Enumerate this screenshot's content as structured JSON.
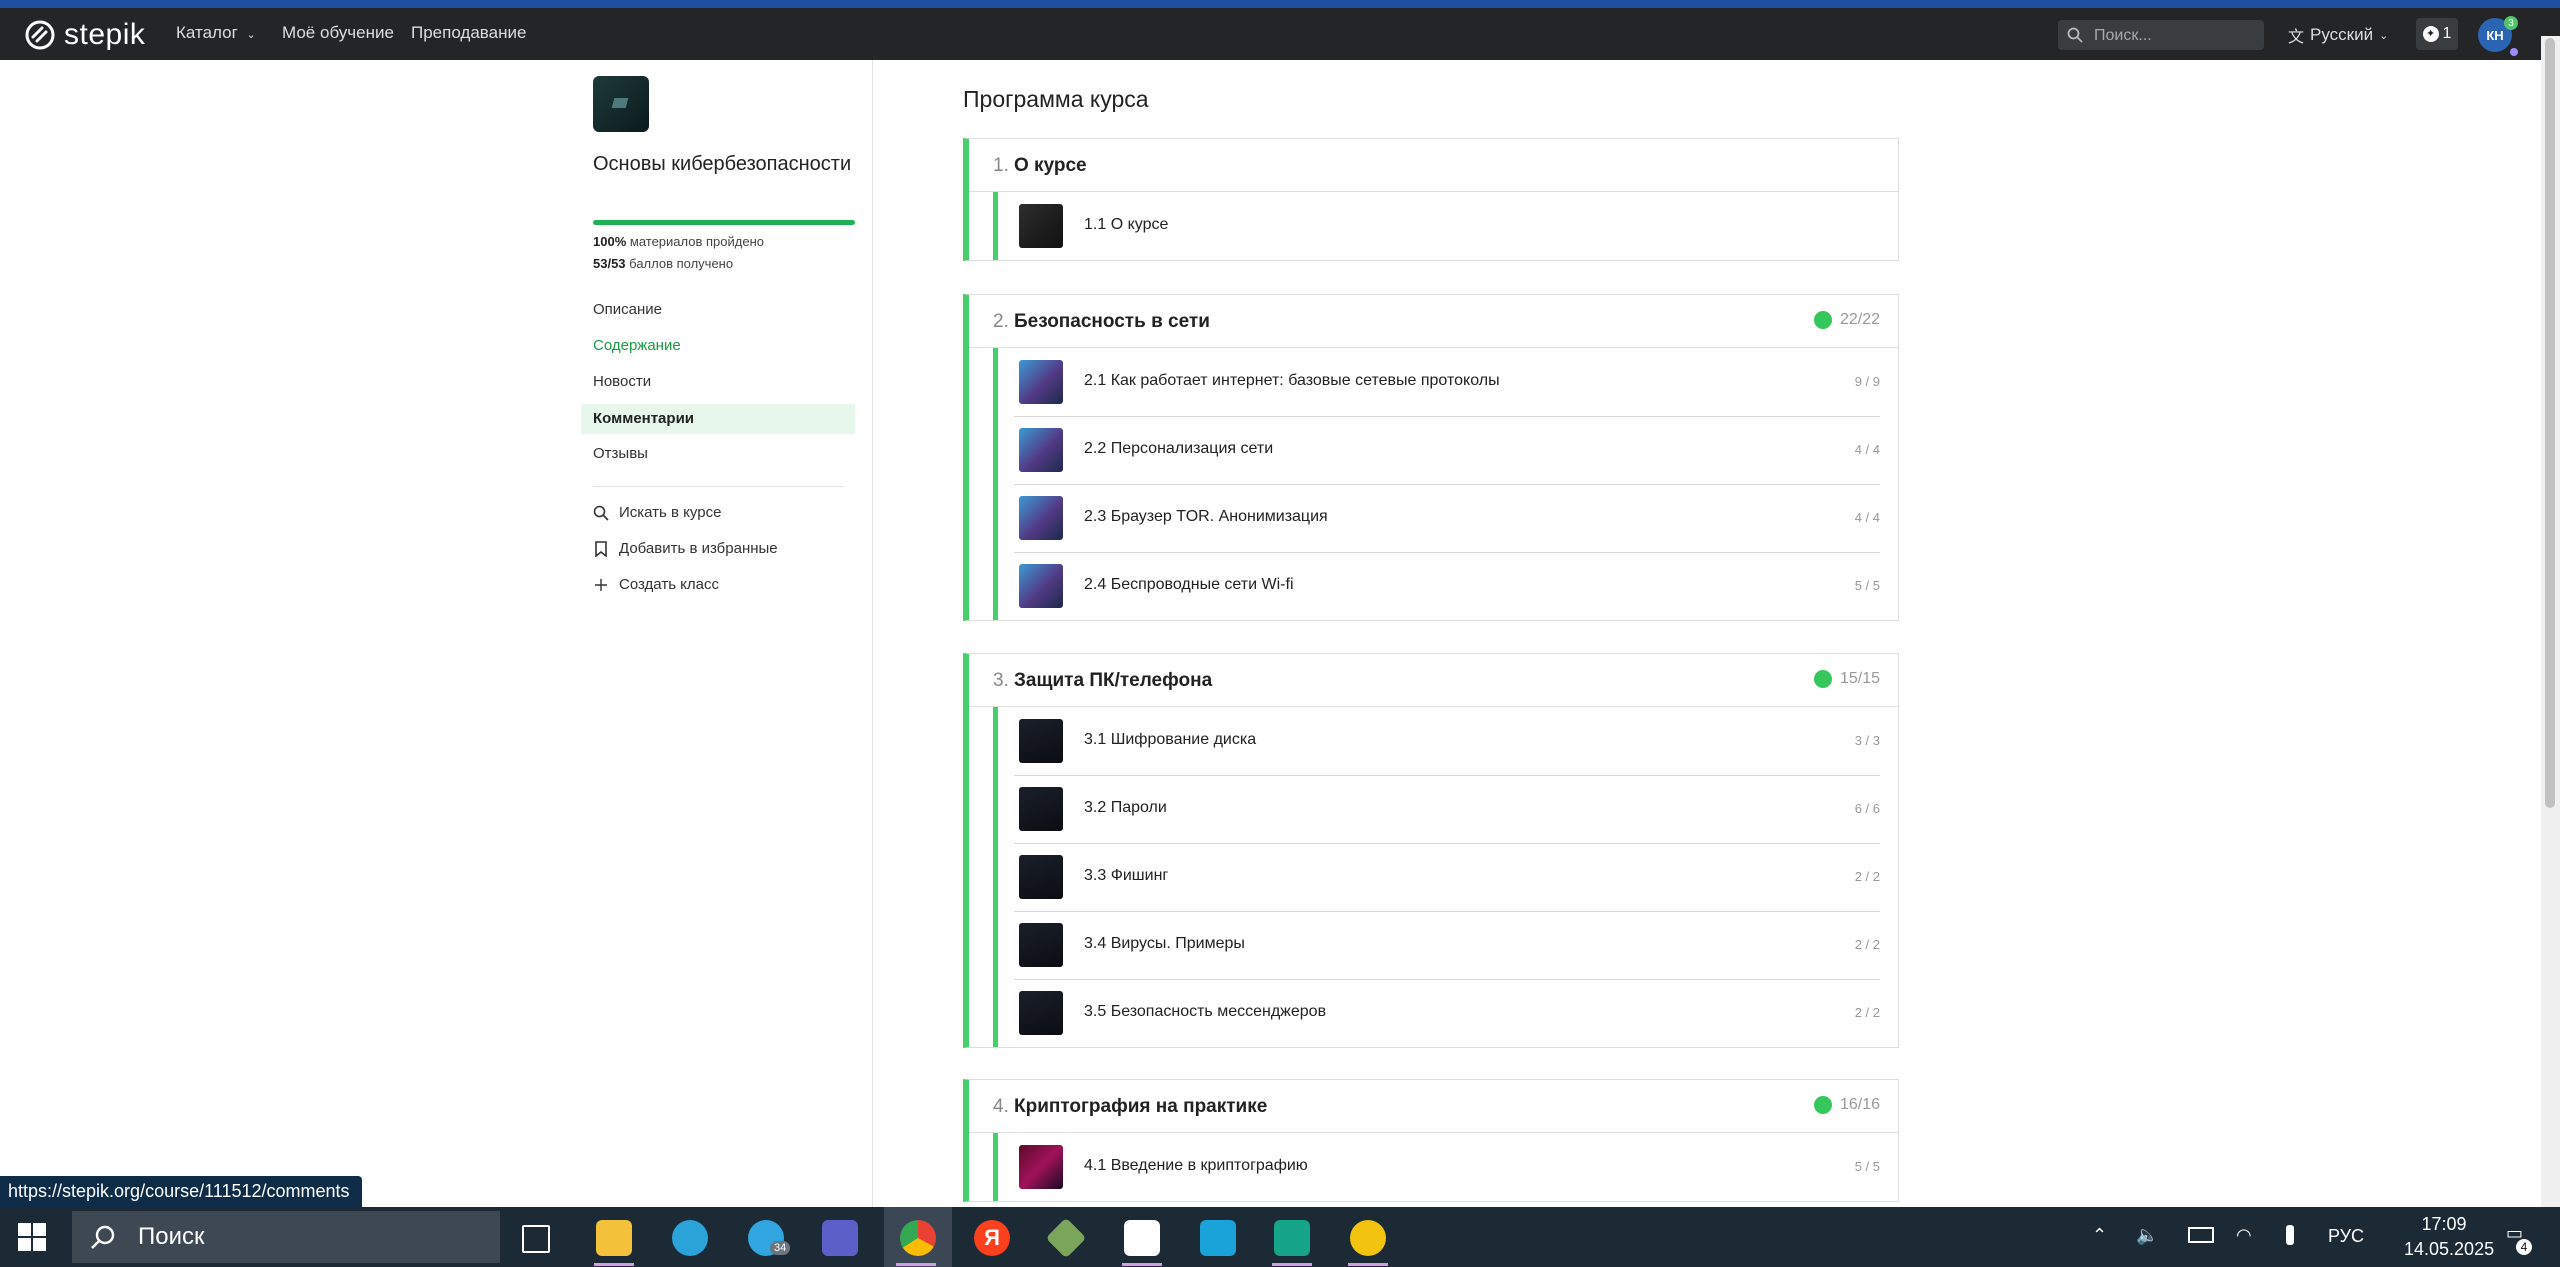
{
  "navbar": {
    "logo": "stepik",
    "catalog": "Каталог",
    "my_learning": "Моё обучение",
    "teaching": "Преподавание",
    "search_placeholder": "Поиск...",
    "language": "Русский",
    "notifications_count": "1",
    "avatar_initials": "КН",
    "avatar_badge": "3"
  },
  "sidebar": {
    "course_title": "Основы кибербезопасности",
    "progress_fraction": 1.0,
    "progress_percent": "100%",
    "progress_text": "материалов пройдено",
    "points": "53/53",
    "points_text": "баллов получено",
    "links": [
      "Описание",
      "Содержание",
      "Новости",
      "Комментарии",
      "Отзывы"
    ],
    "actions": [
      "Искать в курсе",
      "Добавить в избранные",
      "Создать класс"
    ]
  },
  "program": {
    "title": "Программа курса",
    "modules": [
      {
        "num": "1.",
        "title": "О курсе",
        "score": "",
        "lessons": [
          {
            "title": "1.1 О курсе",
            "score": ""
          }
        ]
      },
      {
        "num": "2.",
        "title": "Безопасность в сети",
        "score": "22/22",
        "lessons": [
          {
            "title": "2.1 Как работает интернет: базовые сетевые протоколы",
            "score": "9 / 9"
          },
          {
            "title": "2.2 Персонализация сети",
            "score": "4 / 4"
          },
          {
            "title": "2.3 Браузер TOR. Анонимизация",
            "score": "4 / 4"
          },
          {
            "title": "2.4 Беспроводные сети Wi-fi",
            "score": "5 / 5"
          }
        ]
      },
      {
        "num": "3.",
        "title": "Защита ПК/телефона",
        "score": "15/15",
        "lessons": [
          {
            "title": "3.1 Шифрование диска",
            "score": "3 / 3"
          },
          {
            "title": "3.2 Пароли",
            "score": "6 / 6"
          },
          {
            "title": "3.3 Фишинг",
            "score": "2 / 2"
          },
          {
            "title": "3.4 Вирусы. Примеры",
            "score": "2 / 2"
          },
          {
            "title": "3.5 Безопасность мессенджеров",
            "score": "2 / 2"
          }
        ]
      },
      {
        "num": "4.",
        "title": "Криптография на практике",
        "score": "16/16",
        "lessons": [
          {
            "title": "4.1 Введение в криптографию",
            "score": "5 / 5"
          }
        ]
      }
    ]
  },
  "statusbar": "https://stepik.org/course/111512/comments",
  "taskbar": {
    "search_label": "Поиск",
    "telegram_badge": "34",
    "lang": "РУС",
    "time": "17:09",
    "date": "14.05.2025",
    "notif_count": "4"
  },
  "colors": {
    "accent_green": "#46d06b",
    "navbar_bg": "#232527",
    "taskbar_bg": "#1c2a36"
  }
}
